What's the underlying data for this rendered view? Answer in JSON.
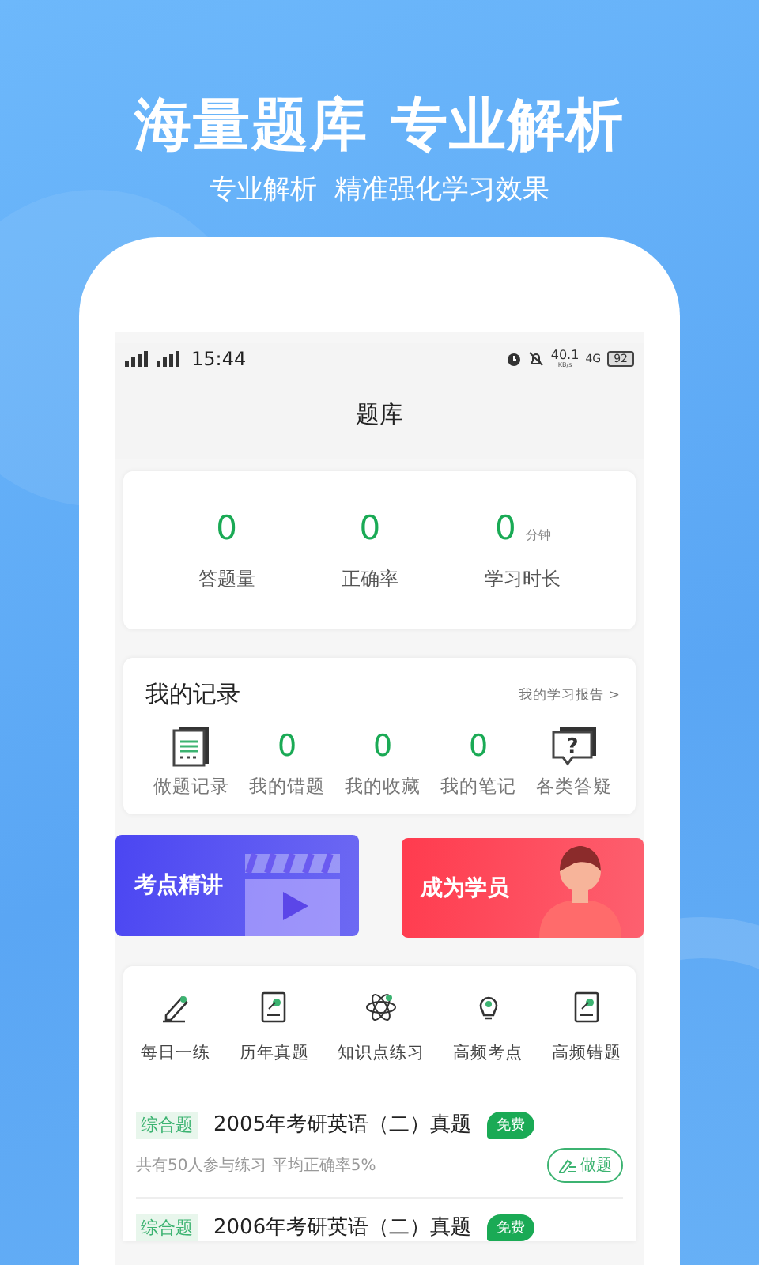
{
  "hero": {
    "title": "海量题库 专业解析",
    "subtitle": "专业解析  精准强化学习效果"
  },
  "status_bar": {
    "time": "15:44",
    "speed": "40.1",
    "speed_unit": "KB/s",
    "network": "4G",
    "battery": "92"
  },
  "header": {
    "title": "题库"
  },
  "stats": [
    {
      "value": "0",
      "label": "答题量"
    },
    {
      "value": "0",
      "label": "正确率"
    },
    {
      "value": "0",
      "unit": "分钟",
      "label": "学习时长"
    }
  ],
  "records": {
    "title": "我的记录",
    "report_link": "我的学习报告 >",
    "items": [
      {
        "kind": "icon",
        "label": "做题记录"
      },
      {
        "kind": "count",
        "value": "0",
        "label": "我的错题"
      },
      {
        "kind": "count",
        "value": "0",
        "label": "我的收藏"
      },
      {
        "kind": "count",
        "value": "0",
        "label": "我的笔记"
      },
      {
        "kind": "icon",
        "glyph": "?",
        "label": "各类答疑"
      }
    ]
  },
  "banners": [
    {
      "title": "考点精讲",
      "color": "#4b46f2"
    },
    {
      "title": "成为学员",
      "color": "#ff3b4e"
    }
  ],
  "shortcuts": [
    "每日一练",
    "历年真题",
    "知识点练习",
    "高频考点",
    "高频错题"
  ],
  "questions": [
    {
      "tag": "综合题",
      "title": "2005年考研英语（二）真题",
      "badge": "免费",
      "meta": "共有50人参与练习 平均正确率5%",
      "action": "做题"
    },
    {
      "tag": "综合题",
      "title": "2006年考研英语（二）真题",
      "badge": "免费"
    }
  ]
}
